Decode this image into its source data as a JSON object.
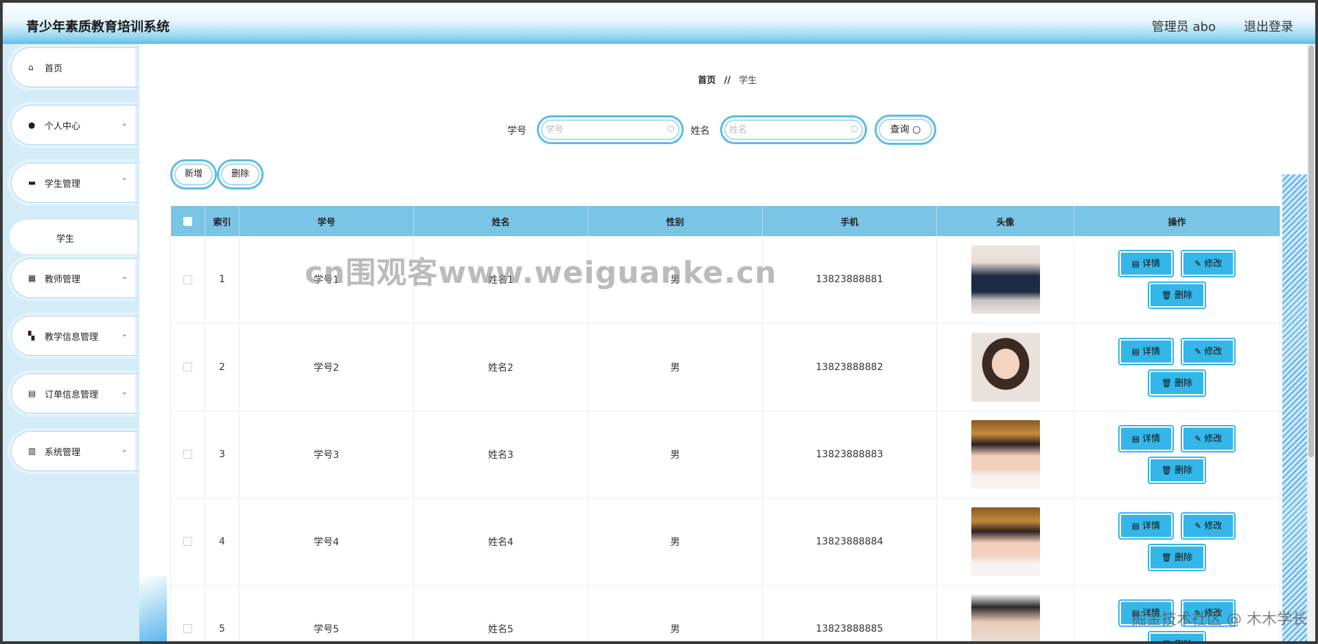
{
  "header": {
    "title": "青少年素质教育培训系统",
    "admin": "管理员 abo",
    "logout": "退出登录"
  },
  "sidebar": {
    "items": [
      {
        "label": "首页",
        "icon": "home-icon",
        "has_chevron": false
      },
      {
        "label": "个人中心",
        "icon": "user-icon",
        "has_chevron": true
      },
      {
        "label": "学生管理",
        "icon": "briefcase-icon",
        "has_chevron": true
      },
      {
        "label": "教师管理",
        "icon": "grid-icon",
        "has_chevron": true
      },
      {
        "label": "教学信息管理",
        "icon": "apps-icon",
        "has_chevron": true
      },
      {
        "label": "订单信息管理",
        "icon": "clipboard-icon",
        "has_chevron": true
      },
      {
        "label": "系统管理",
        "icon": "book-icon",
        "has_chevron": true
      }
    ],
    "sub_item": "学生"
  },
  "breadcrumb": {
    "home": "首页",
    "separator": "//",
    "current": "学生"
  },
  "search": {
    "id_label": "学号",
    "id_placeholder": "学号",
    "name_label": "姓名",
    "name_placeholder": "姓名",
    "query_button": "查询"
  },
  "actions": {
    "add": "新增",
    "delete": "删除"
  },
  "table": {
    "headers": [
      "",
      "索引",
      "学号",
      "姓名",
      "性别",
      "手机",
      "头像",
      "操作"
    ],
    "rows": [
      {
        "index": "1",
        "student_id": "学号1",
        "name": "姓名1",
        "gender": "男",
        "phone": "13823888881"
      },
      {
        "index": "2",
        "student_id": "学号2",
        "name": "姓名2",
        "gender": "男",
        "phone": "13823888882"
      },
      {
        "index": "3",
        "student_id": "学号3",
        "name": "姓名3",
        "gender": "男",
        "phone": "13823888883"
      },
      {
        "index": "4",
        "student_id": "学号4",
        "name": "姓名4",
        "gender": "男",
        "phone": "13823888884"
      },
      {
        "index": "5",
        "student_id": "学号5",
        "name": "姓名5",
        "gender": "男",
        "phone": "13823888885"
      }
    ],
    "row_actions": {
      "detail": "详情",
      "edit": "修改",
      "delete": "删除"
    }
  },
  "watermark": "cn围观客www.weiguanke.cn",
  "footer_mark": "掘金技术社区 @ 木木学长",
  "colors": {
    "accent": "#34b6e9",
    "table_header": "#7ac4e6",
    "sidebar_bg": "#d4ecf8"
  }
}
